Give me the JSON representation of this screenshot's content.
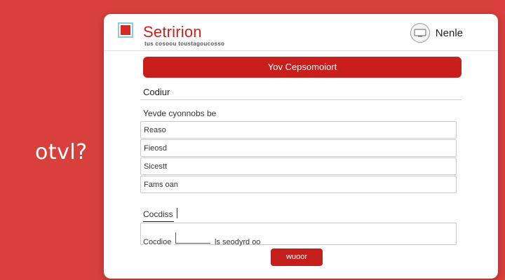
{
  "side_text": "otvl?",
  "header": {
    "app_title": "Setririon",
    "app_subtitle": "tus cosoou toustagoucosso",
    "user_name": "Nenle"
  },
  "banner_label": "Yov Cepsomoiort",
  "section_heading": "Codiur",
  "form_caption": "Yevde cyonnobs be",
  "fields": [
    {
      "label": "Reaso"
    },
    {
      "label": "Fieosd"
    },
    {
      "label": "Sicestt"
    },
    {
      "label": "Fams oan"
    }
  ],
  "subsection_label": "Cocdiss",
  "big_box_label": "Cocdioe",
  "big_box_caption": "ls seodyrd oo",
  "submit_label": "wuoor",
  "colors": {
    "background": "#d8403c",
    "accent": "#c81e1c",
    "title": "#c8231e",
    "card": "#ffffff"
  },
  "icons": {
    "logo": "red-square-logo-icon",
    "avatar": "user-avatar-icon"
  }
}
